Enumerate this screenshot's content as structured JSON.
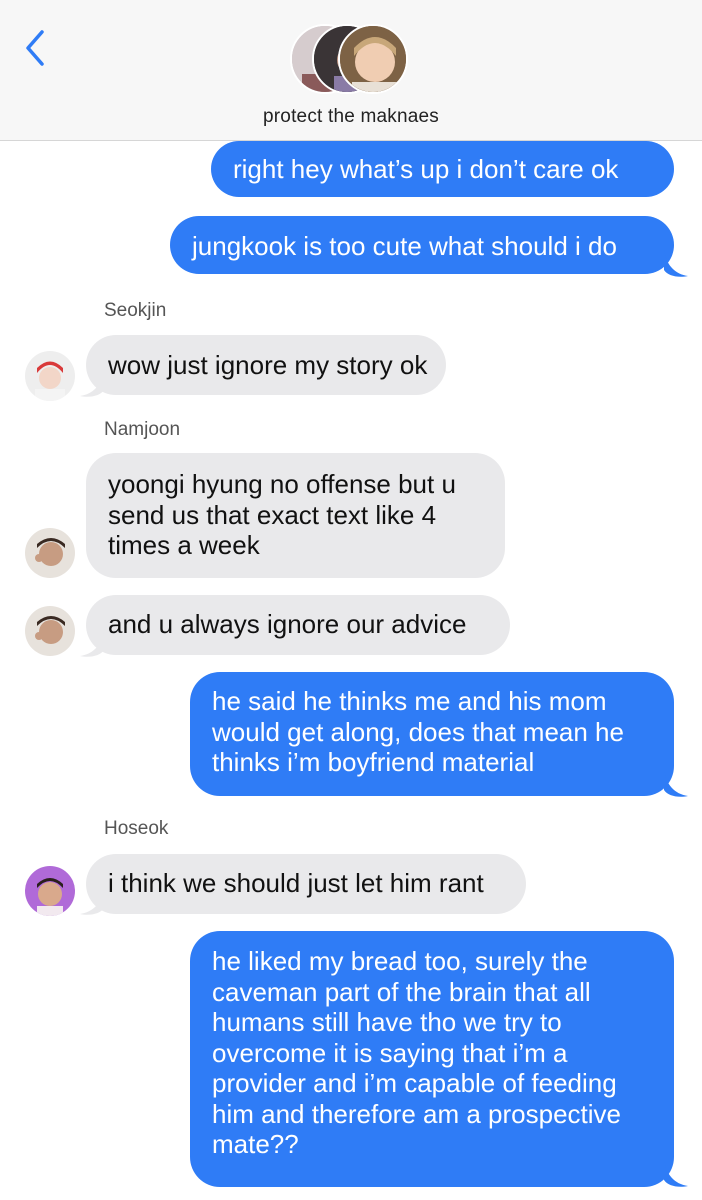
{
  "header": {
    "group_name": "protect the maknaes",
    "back_icon": "chevron-left-icon",
    "accent": "#2f7cf6"
  },
  "colors": {
    "outgoing_bubble": "#2f7cf6",
    "incoming_bubble": "#e9e9eb"
  },
  "messages": [
    {
      "direction": "out",
      "lines": [
        "right hey what’s up i don’t care ok"
      ]
    },
    {
      "direction": "out",
      "lines": [
        "jungkook is too cute what should i do"
      ]
    },
    {
      "direction": "in",
      "sender": "Seokjin",
      "lines": [
        "wow just ignore my story ok"
      ]
    },
    {
      "direction": "in",
      "sender": "Namjoon",
      "lines": [
        "yoongi hyung no offense but u",
        "send us that exact text like 4",
        "times a week"
      ]
    },
    {
      "direction": "in",
      "lines": [
        "and u always ignore our advice"
      ]
    },
    {
      "direction": "out",
      "lines": [
        "he said he thinks me and his mom",
        "would get along, does that mean he",
        "thinks i’m boyfriend material"
      ]
    },
    {
      "direction": "in",
      "sender": "Hoseok",
      "lines": [
        "i think we should just let him rant"
      ]
    },
    {
      "direction": "out",
      "lines": [
        "he liked my bread too, surely the",
        "caveman part of the brain that all",
        "humans still have tho we try to",
        "overcome it is saying that i’m a",
        "provider and i’m capable of feeding",
        "him and therefore am a prospective",
        "mate??"
      ]
    }
  ]
}
